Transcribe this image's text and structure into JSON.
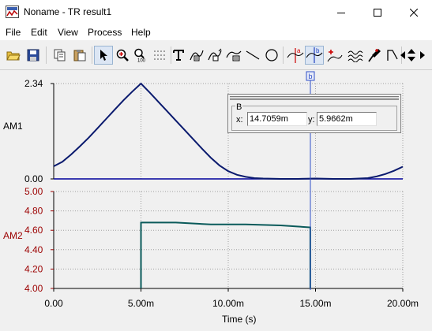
{
  "window": {
    "title": "Noname - TR result1",
    "minimize_icon": "minimize-icon",
    "maximize_icon": "maximize-icon",
    "close_icon": "close-icon"
  },
  "menu": [
    "File",
    "Edit",
    "View",
    "Process",
    "Help"
  ],
  "toolbar": [
    "open-folder-icon",
    "save-icon",
    "copy-icon",
    "paste-icon",
    "pointer-icon",
    "zoom-in-icon",
    "zoom-100-icon",
    "grid-icon",
    "text-tool-icon",
    "annotate-curve-icon",
    "annotate-curve-2-icon",
    "annotate-area-icon",
    "line-tool-icon",
    "circle-tool-icon",
    "cursor-a-icon",
    "cursor-b-icon",
    "add-cursor-icon",
    "waveform-icon",
    "probe-icon",
    "trigger-icon",
    "arrow-left-icon",
    "arrow-updown-icon",
    "arrow-right-icon"
  ],
  "cursor_panel": {
    "group_label": "B",
    "x_label": "x:",
    "x_value": "14.7059m",
    "y_label": "y:",
    "y_value": "5.9662m"
  },
  "cursor_marker_label": "b",
  "chart_data": [
    {
      "type": "line",
      "ylabel": "AM1",
      "ylim": [
        0.0,
        2.34
      ],
      "y_ticks": [
        "2.34",
        "0.00"
      ],
      "xlim": [
        0,
        20
      ],
      "x_unit": "m",
      "color": "#0a1a6e",
      "series": [
        {
          "x": [
            0.0,
            0.5,
            1.0,
            1.5,
            2.0,
            2.5,
            3.0,
            3.5,
            4.0,
            4.5,
            5.0,
            5.5,
            6.0,
            6.5,
            7.0,
            7.5,
            8.0,
            8.5,
            9.0,
            9.5,
            10.0,
            10.5,
            11.0,
            11.5,
            12.0,
            13.0,
            14.0,
            15.0,
            16.0,
            17.0,
            18.0,
            18.5,
            19.0,
            19.5,
            20.0
          ],
          "y": [
            0.31,
            0.42,
            0.6,
            0.8,
            1.01,
            1.24,
            1.47,
            1.7,
            1.93,
            2.14,
            2.34,
            2.12,
            1.89,
            1.66,
            1.43,
            1.2,
            0.97,
            0.74,
            0.52,
            0.33,
            0.19,
            0.1,
            0.05,
            0.02,
            0.01,
            0.0,
            0.0,
            0.01,
            0.0,
            0.0,
            0.02,
            0.06,
            0.12,
            0.2,
            0.3
          ]
        }
      ]
    },
    {
      "type": "line",
      "ylabel": "AM2",
      "ylim": [
        4.0,
        5.0
      ],
      "y_ticks": [
        "5.00",
        "4.80",
        "4.60",
        "4.40",
        "4.20",
        "4.00"
      ],
      "xlim": [
        0,
        20
      ],
      "x_unit": "m",
      "color": "#0a5a5a",
      "series": [
        {
          "x": [
            5.0,
            5.0,
            7.0,
            9.0,
            11.0,
            13.0,
            14.7,
            14.7
          ],
          "y": [
            4.0,
            4.68,
            4.68,
            4.66,
            4.66,
            4.65,
            4.63,
            4.0
          ]
        }
      ]
    }
  ],
  "x_ticks": [
    "0.00",
    "5.00m",
    "10.00m",
    "15.00m",
    "20.00m"
  ],
  "xlabel": "Time (s)"
}
